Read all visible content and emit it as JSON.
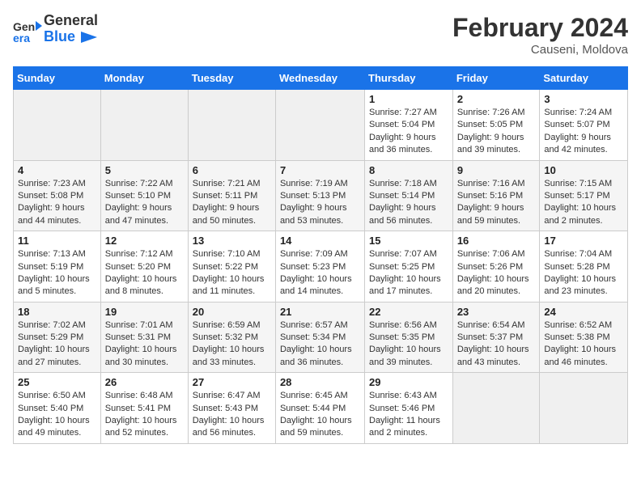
{
  "header": {
    "logo_line1": "General",
    "logo_line2": "Blue",
    "month": "February 2024",
    "location": "Causeni, Moldova"
  },
  "weekdays": [
    "Sunday",
    "Monday",
    "Tuesday",
    "Wednesday",
    "Thursday",
    "Friday",
    "Saturday"
  ],
  "weeks": [
    [
      {
        "day": "",
        "info": ""
      },
      {
        "day": "",
        "info": ""
      },
      {
        "day": "",
        "info": ""
      },
      {
        "day": "",
        "info": ""
      },
      {
        "day": "1",
        "info": "Sunrise: 7:27 AM\nSunset: 5:04 PM\nDaylight: 9 hours\nand 36 minutes."
      },
      {
        "day": "2",
        "info": "Sunrise: 7:26 AM\nSunset: 5:05 PM\nDaylight: 9 hours\nand 39 minutes."
      },
      {
        "day": "3",
        "info": "Sunrise: 7:24 AM\nSunset: 5:07 PM\nDaylight: 9 hours\nand 42 minutes."
      }
    ],
    [
      {
        "day": "4",
        "info": "Sunrise: 7:23 AM\nSunset: 5:08 PM\nDaylight: 9 hours\nand 44 minutes."
      },
      {
        "day": "5",
        "info": "Sunrise: 7:22 AM\nSunset: 5:10 PM\nDaylight: 9 hours\nand 47 minutes."
      },
      {
        "day": "6",
        "info": "Sunrise: 7:21 AM\nSunset: 5:11 PM\nDaylight: 9 hours\nand 50 minutes."
      },
      {
        "day": "7",
        "info": "Sunrise: 7:19 AM\nSunset: 5:13 PM\nDaylight: 9 hours\nand 53 minutes."
      },
      {
        "day": "8",
        "info": "Sunrise: 7:18 AM\nSunset: 5:14 PM\nDaylight: 9 hours\nand 56 minutes."
      },
      {
        "day": "9",
        "info": "Sunrise: 7:16 AM\nSunset: 5:16 PM\nDaylight: 9 hours\nand 59 minutes."
      },
      {
        "day": "10",
        "info": "Sunrise: 7:15 AM\nSunset: 5:17 PM\nDaylight: 10 hours\nand 2 minutes."
      }
    ],
    [
      {
        "day": "11",
        "info": "Sunrise: 7:13 AM\nSunset: 5:19 PM\nDaylight: 10 hours\nand 5 minutes."
      },
      {
        "day": "12",
        "info": "Sunrise: 7:12 AM\nSunset: 5:20 PM\nDaylight: 10 hours\nand 8 minutes."
      },
      {
        "day": "13",
        "info": "Sunrise: 7:10 AM\nSunset: 5:22 PM\nDaylight: 10 hours\nand 11 minutes."
      },
      {
        "day": "14",
        "info": "Sunrise: 7:09 AM\nSunset: 5:23 PM\nDaylight: 10 hours\nand 14 minutes."
      },
      {
        "day": "15",
        "info": "Sunrise: 7:07 AM\nSunset: 5:25 PM\nDaylight: 10 hours\nand 17 minutes."
      },
      {
        "day": "16",
        "info": "Sunrise: 7:06 AM\nSunset: 5:26 PM\nDaylight: 10 hours\nand 20 minutes."
      },
      {
        "day": "17",
        "info": "Sunrise: 7:04 AM\nSunset: 5:28 PM\nDaylight: 10 hours\nand 23 minutes."
      }
    ],
    [
      {
        "day": "18",
        "info": "Sunrise: 7:02 AM\nSunset: 5:29 PM\nDaylight: 10 hours\nand 27 minutes."
      },
      {
        "day": "19",
        "info": "Sunrise: 7:01 AM\nSunset: 5:31 PM\nDaylight: 10 hours\nand 30 minutes."
      },
      {
        "day": "20",
        "info": "Sunrise: 6:59 AM\nSunset: 5:32 PM\nDaylight: 10 hours\nand 33 minutes."
      },
      {
        "day": "21",
        "info": "Sunrise: 6:57 AM\nSunset: 5:34 PM\nDaylight: 10 hours\nand 36 minutes."
      },
      {
        "day": "22",
        "info": "Sunrise: 6:56 AM\nSunset: 5:35 PM\nDaylight: 10 hours\nand 39 minutes."
      },
      {
        "day": "23",
        "info": "Sunrise: 6:54 AM\nSunset: 5:37 PM\nDaylight: 10 hours\nand 43 minutes."
      },
      {
        "day": "24",
        "info": "Sunrise: 6:52 AM\nSunset: 5:38 PM\nDaylight: 10 hours\nand 46 minutes."
      }
    ],
    [
      {
        "day": "25",
        "info": "Sunrise: 6:50 AM\nSunset: 5:40 PM\nDaylight: 10 hours\nand 49 minutes."
      },
      {
        "day": "26",
        "info": "Sunrise: 6:48 AM\nSunset: 5:41 PM\nDaylight: 10 hours\nand 52 minutes."
      },
      {
        "day": "27",
        "info": "Sunrise: 6:47 AM\nSunset: 5:43 PM\nDaylight: 10 hours\nand 56 minutes."
      },
      {
        "day": "28",
        "info": "Sunrise: 6:45 AM\nSunset: 5:44 PM\nDaylight: 10 hours\nand 59 minutes."
      },
      {
        "day": "29",
        "info": "Sunrise: 6:43 AM\nSunset: 5:46 PM\nDaylight: 11 hours\nand 2 minutes."
      },
      {
        "day": "",
        "info": ""
      },
      {
        "day": "",
        "info": ""
      }
    ]
  ]
}
